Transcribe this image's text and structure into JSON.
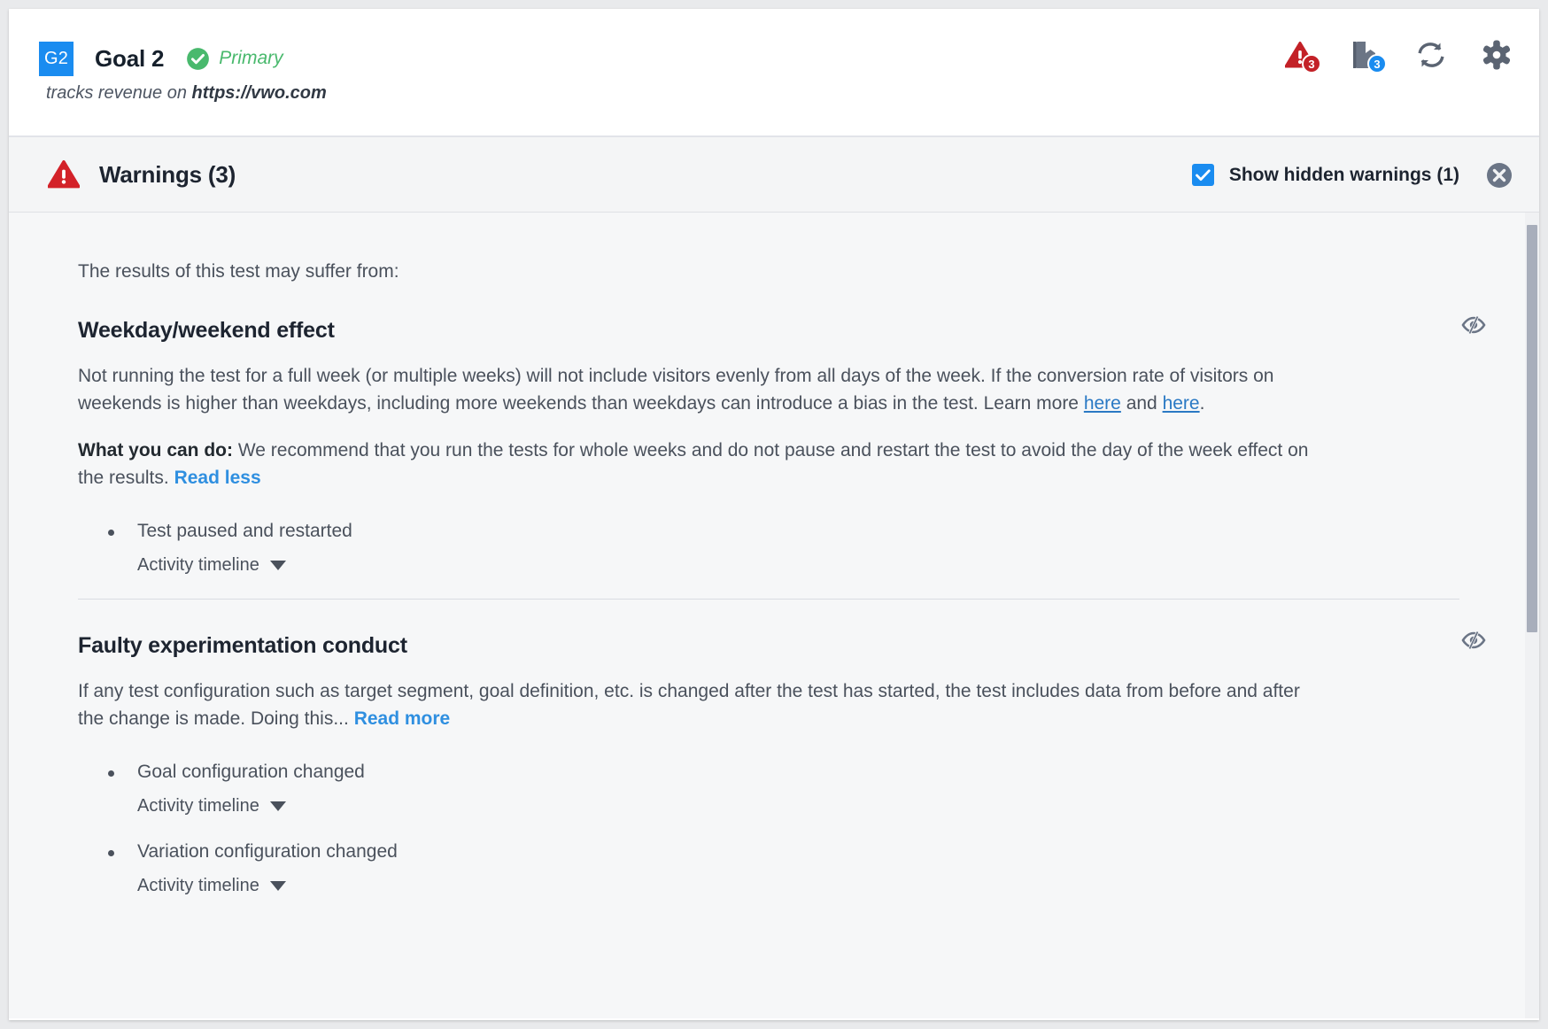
{
  "goal": {
    "badge": "G2",
    "title": "Goal 2",
    "primary_label": "Primary",
    "subtitle_prefix": "tracks revenue on ",
    "subtitle_url": "https://vwo.com"
  },
  "header_icons": [
    {
      "name": "warning-icon",
      "badge": "3",
      "badge_color": "#c32127"
    },
    {
      "name": "notes-icon",
      "badge": "3",
      "badge_color": "#1a8cf0"
    },
    {
      "name": "refresh-icon",
      "badge": "",
      "badge_color": ""
    },
    {
      "name": "settings-gear-icon",
      "badge": "",
      "badge_color": ""
    }
  ],
  "warnings_bar": {
    "title": "Warnings (3)",
    "show_hidden_label": "Show hidden warnings (1)",
    "show_hidden_checked": true,
    "close_label": "Close"
  },
  "body": {
    "intro": "The results of this test may suffer from:",
    "sections": [
      {
        "title": "Weekday/weekend effect",
        "paragraph_1_a": "Not running the test for a full week (or multiple weeks) will not include visitors evenly from all days of the week. If the conversion rate of visitors on weekends is higher than weekdays, including more weekends than weekdays can introduce a bias in the test. Learn more ",
        "link_1": "here",
        "paragraph_1_b": " and ",
        "link_2": "here",
        "paragraph_1_c": ".",
        "advice_label": "What you can do:",
        "advice_text": " We recommend that you run the tests for whole weeks and do not pause and restart the test to avoid the day of the week effect on the results. ",
        "advice_link": "Read less",
        "items": [
          {
            "label": "Test paused and restarted",
            "timeline": "Activity timeline"
          }
        ]
      },
      {
        "title": "Faulty experimentation conduct",
        "paragraph_1_a": "If any test configuration such as target segment, goal definition, etc. is changed after the test has started, the test includes data from before and after the change is made. Doing this... ",
        "read_more": "Read more",
        "items": [
          {
            "label": "Goal configuration changed",
            "timeline": "Activity timeline"
          },
          {
            "label": "Variation configuration changed",
            "timeline": "Activity timeline"
          }
        ]
      }
    ]
  },
  "colors": {
    "accent_blue": "#1a8cf0",
    "warning_red": "#c32127",
    "success_green": "#49b96d",
    "link_blue": "#2f8fe0",
    "panel_bg": "#f6f7f8"
  }
}
